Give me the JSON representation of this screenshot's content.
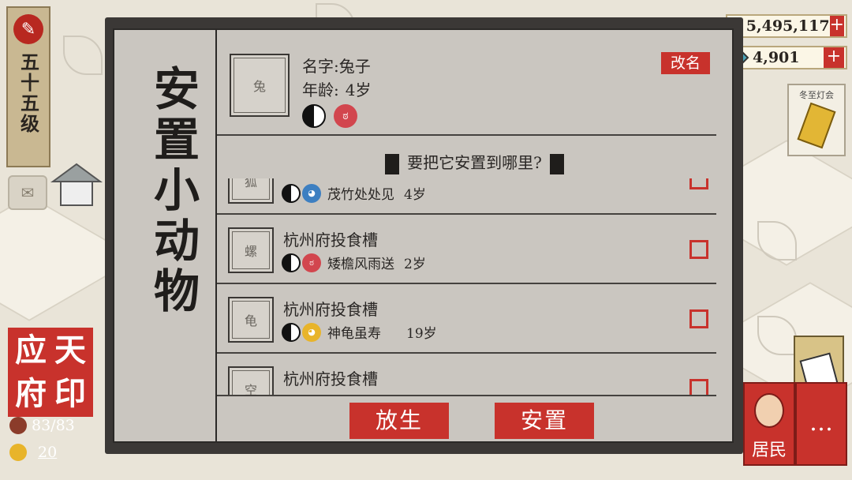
{
  "hud": {
    "level": "五十五级",
    "city_seal": [
      "应",
      "天",
      "府",
      "印"
    ],
    "population": "83/83",
    "citizens": "20",
    "coins": "5,495,117",
    "gems": "4,901",
    "festival_label": "冬至灯会",
    "people_label": "居民"
  },
  "dialog": {
    "title": "安置小动物",
    "rename_label": "改名",
    "pet": {
      "name_label": "名字:",
      "name": "兔子",
      "age_label": "年龄:",
      "age": "4岁",
      "thumb_glyph": "兔"
    },
    "question": "要把它安置到哪里?",
    "list": [
      {
        "location": "",
        "animal": "茂竹处处见",
        "age": "4岁",
        "trait2_color": "#3d7fc1",
        "thumb_glyph": "狐"
      },
      {
        "location": "杭州府投食槽",
        "animal": "矮檐风雨送",
        "age": "2岁",
        "trait2_color": "#d2464e",
        "thumb_glyph": "螺"
      },
      {
        "location": "杭州府投食槽",
        "animal": "神龟虽寿",
        "age": "19岁",
        "trait2_color": "#e8b42a",
        "thumb_glyph": "龟"
      },
      {
        "location": "杭州府投食槽",
        "animal": "",
        "age": "",
        "trait2_color": "#d2464e",
        "thumb_glyph": "空"
      }
    ],
    "release_button": "放生",
    "place_button": "安置"
  }
}
